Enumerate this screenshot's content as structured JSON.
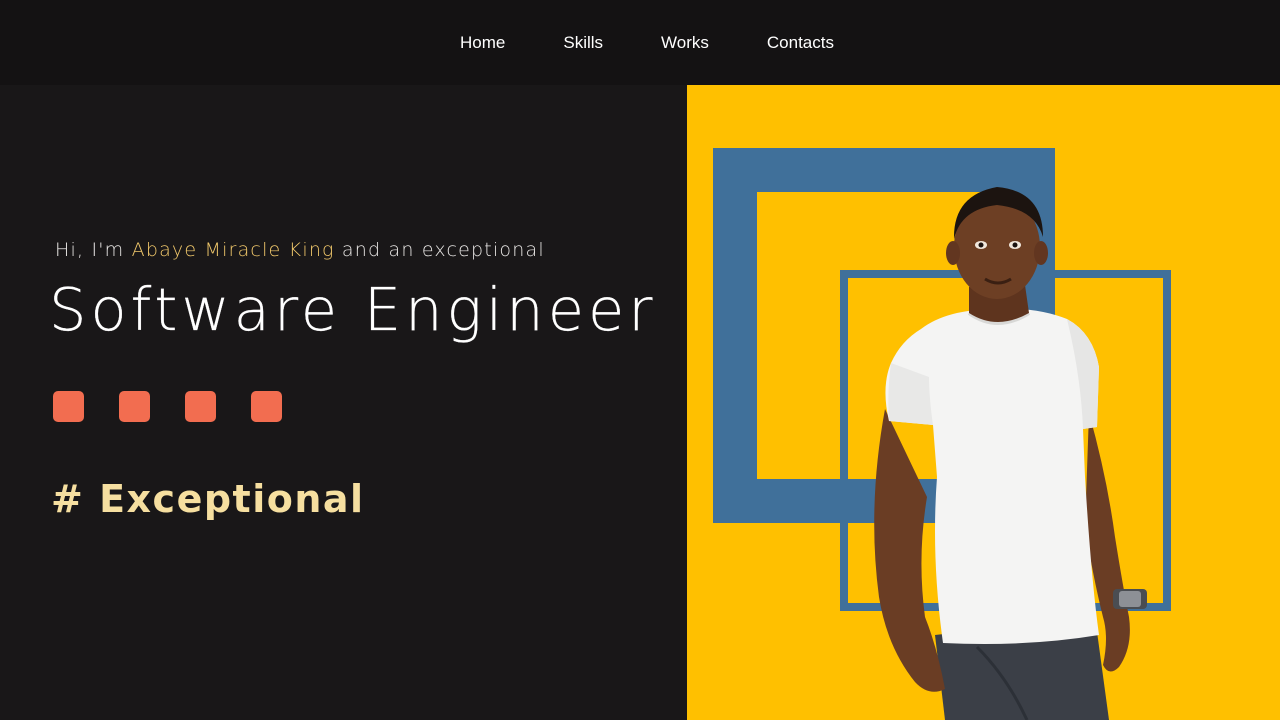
{
  "nav": {
    "links": [
      {
        "label": "Home"
      },
      {
        "label": "Skills"
      },
      {
        "label": "Works"
      },
      {
        "label": "Contacts"
      }
    ]
  },
  "hero": {
    "intro_prefix": "Hi, I'm ",
    "intro_name": "Abaye Miracle King",
    "intro_suffix": " and an exceptional",
    "role": "Software Engineer",
    "tagline": "# Exceptional",
    "square_count": 4
  },
  "colors": {
    "background": "#191718",
    "nav_background": "#141213",
    "accent_yellow": "#ffc000",
    "frame_blue": "#40709a",
    "square_coral": "#f26d50",
    "name_gold": "#f2c96b",
    "tagline_cream": "#f6dfa0"
  }
}
